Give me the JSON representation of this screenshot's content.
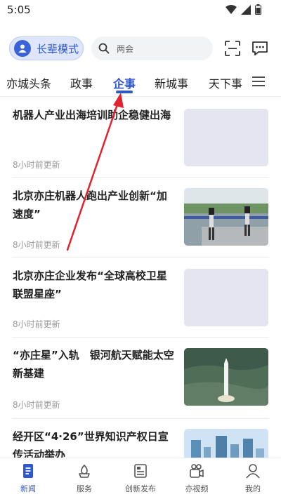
{
  "status": {
    "time": "5:05"
  },
  "header": {
    "elder_mode_label": "长辈模式",
    "search_placeholder": "两会"
  },
  "tabs": [
    {
      "label": "亦城头条"
    },
    {
      "label": "政事"
    },
    {
      "label": "企事",
      "active": true
    },
    {
      "label": "新城事"
    },
    {
      "label": "天下事"
    }
  ],
  "feed": [
    {
      "title": "机器人产业出海培训助企稳健出海",
      "time": "8小时前更新",
      "thumb": "placeholder"
    },
    {
      "title": "北京亦庄机器人跑出产业创新“加速度”",
      "time": "8小时前更新",
      "thumb": "robots-photo"
    },
    {
      "title": "北京亦庄企业发布“全球高校卫星联盟星座”",
      "time": "8小时前更新",
      "thumb": "placeholder"
    },
    {
      "title": "“亦庄星”入轨　银河航天赋能太空新基建",
      "time": "8小时前更新",
      "thumb": "rocket-photo"
    },
    {
      "title": "经开区“4·26”世界知识产权日宣传活动举办",
      "time": "",
      "thumb": "city-photo"
    }
  ],
  "bottom_nav": [
    {
      "label": "新闻",
      "icon": "news-icon",
      "active": true
    },
    {
      "label": "服务",
      "icon": "service-icon"
    },
    {
      "label": "创新发布",
      "icon": "publish-icon"
    },
    {
      "label": "亦视频",
      "icon": "video-icon"
    },
    {
      "label": "我的",
      "icon": "profile-icon"
    }
  ],
  "colors": {
    "accent": "#2f58cf",
    "annotation_arrow": "#e0242f"
  }
}
